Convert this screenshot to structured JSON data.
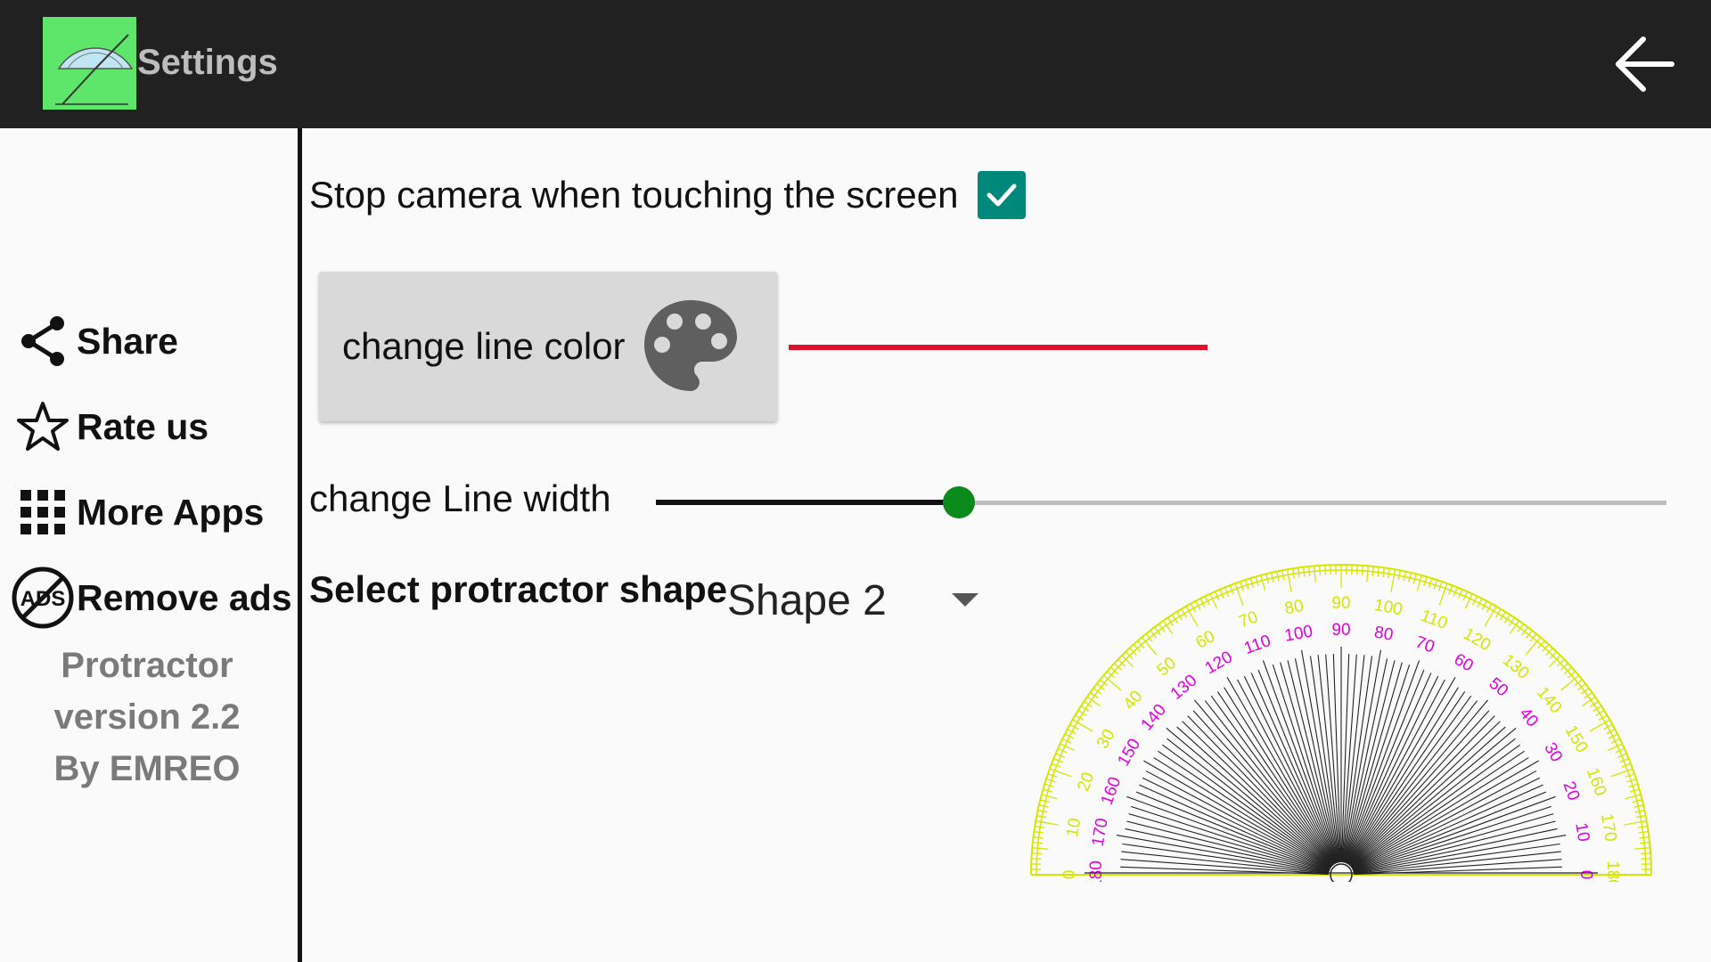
{
  "header": {
    "title": "Settings",
    "app_icon": "protractor-app-icon",
    "back_icon": "arrow-back-icon"
  },
  "sidebar": {
    "items": [
      {
        "label": "Share",
        "icon": "share-icon"
      },
      {
        "label": "Rate us",
        "icon": "star-icon"
      },
      {
        "label": "More Apps",
        "icon": "apps-grid-icon"
      },
      {
        "label": "Remove ads",
        "icon": "no-ads-icon"
      }
    ],
    "version_lines": [
      "Protractor",
      "version 2.2",
      "By EMREO"
    ]
  },
  "settings": {
    "camera_label": "Stop camera when touching the screen",
    "camera_checked": true,
    "color_button_label": "change line color",
    "line_color": "#e0102a",
    "width_label": "change Line width",
    "line_width_fraction": 0.3,
    "shape_label": "Select protractor shape",
    "shape_value": "Shape 2"
  },
  "colors": {
    "accent": "#00897b",
    "slider_thumb": "#0a8a1a",
    "topbar": "#212121",
    "protractor_outer": "#d4e600",
    "protractor_inner": "#e000e0"
  }
}
